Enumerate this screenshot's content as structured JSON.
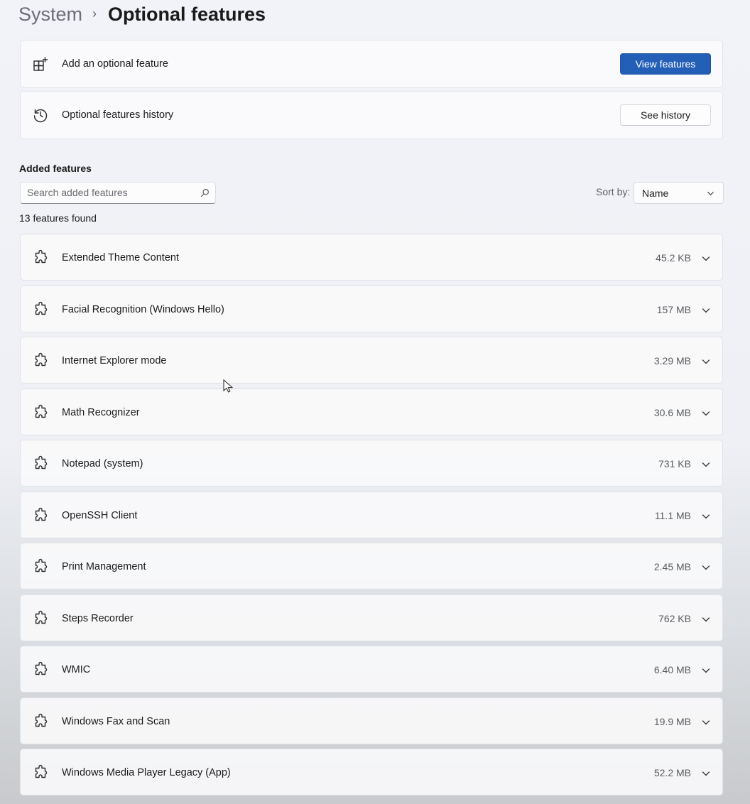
{
  "breadcrumb": {
    "parent": "System",
    "separator": "›",
    "current": "Optional features"
  },
  "add_feature": {
    "label": "Add an optional feature",
    "button": "View features"
  },
  "history": {
    "label": "Optional features history",
    "button": "See history"
  },
  "added": {
    "title": "Added features",
    "search_placeholder": "Search added features",
    "sort_label": "Sort by:",
    "sort_value": "Name",
    "count_text": "13 features found"
  },
  "features": [
    {
      "name": "Extended Theme Content",
      "size": "45.2 KB"
    },
    {
      "name": "Facial Recognition (Windows Hello)",
      "size": "157 MB"
    },
    {
      "name": "Internet Explorer mode",
      "size": "3.29 MB"
    },
    {
      "name": "Math Recognizer",
      "size": "30.6 MB"
    },
    {
      "name": "Notepad (system)",
      "size": "731 KB"
    },
    {
      "name": "OpenSSH Client",
      "size": "11.1 MB"
    },
    {
      "name": "Print Management",
      "size": "2.45 MB"
    },
    {
      "name": "Steps Recorder",
      "size": "762 KB"
    },
    {
      "name": "WMIC",
      "size": "6.40 MB"
    },
    {
      "name": "Windows Fax and Scan",
      "size": "19.9 MB"
    },
    {
      "name": "Windows Media Player Legacy (App)",
      "size": "52.2 MB"
    }
  ],
  "colors": {
    "accent": "#245fb7"
  },
  "icons": {
    "add": "add-feature-icon",
    "history": "history-icon",
    "search": "search-icon",
    "feature": "puzzle-icon",
    "expand": "chevron-down-icon"
  }
}
